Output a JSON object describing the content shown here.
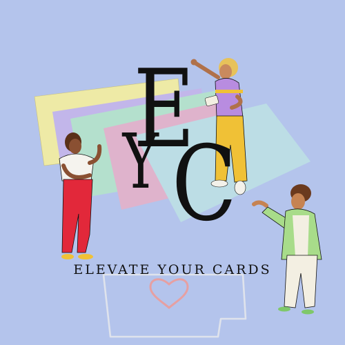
{
  "logo": {
    "letters": [
      "E",
      "Y",
      "C"
    ],
    "tagline": "ELEVATE YOUR CARDS"
  },
  "colors": {
    "background": "#b4c4ec",
    "card_yellow": "#eeeaa6",
    "card_purple": "#c2b6ea",
    "card_green": "#b4e0cd",
    "card_pink": "#dfb3cc",
    "card_blue": "#bcdde5",
    "heart": "#e6a0a2"
  },
  "icons": [
    "heart-icon",
    "folded-card-icon"
  ]
}
